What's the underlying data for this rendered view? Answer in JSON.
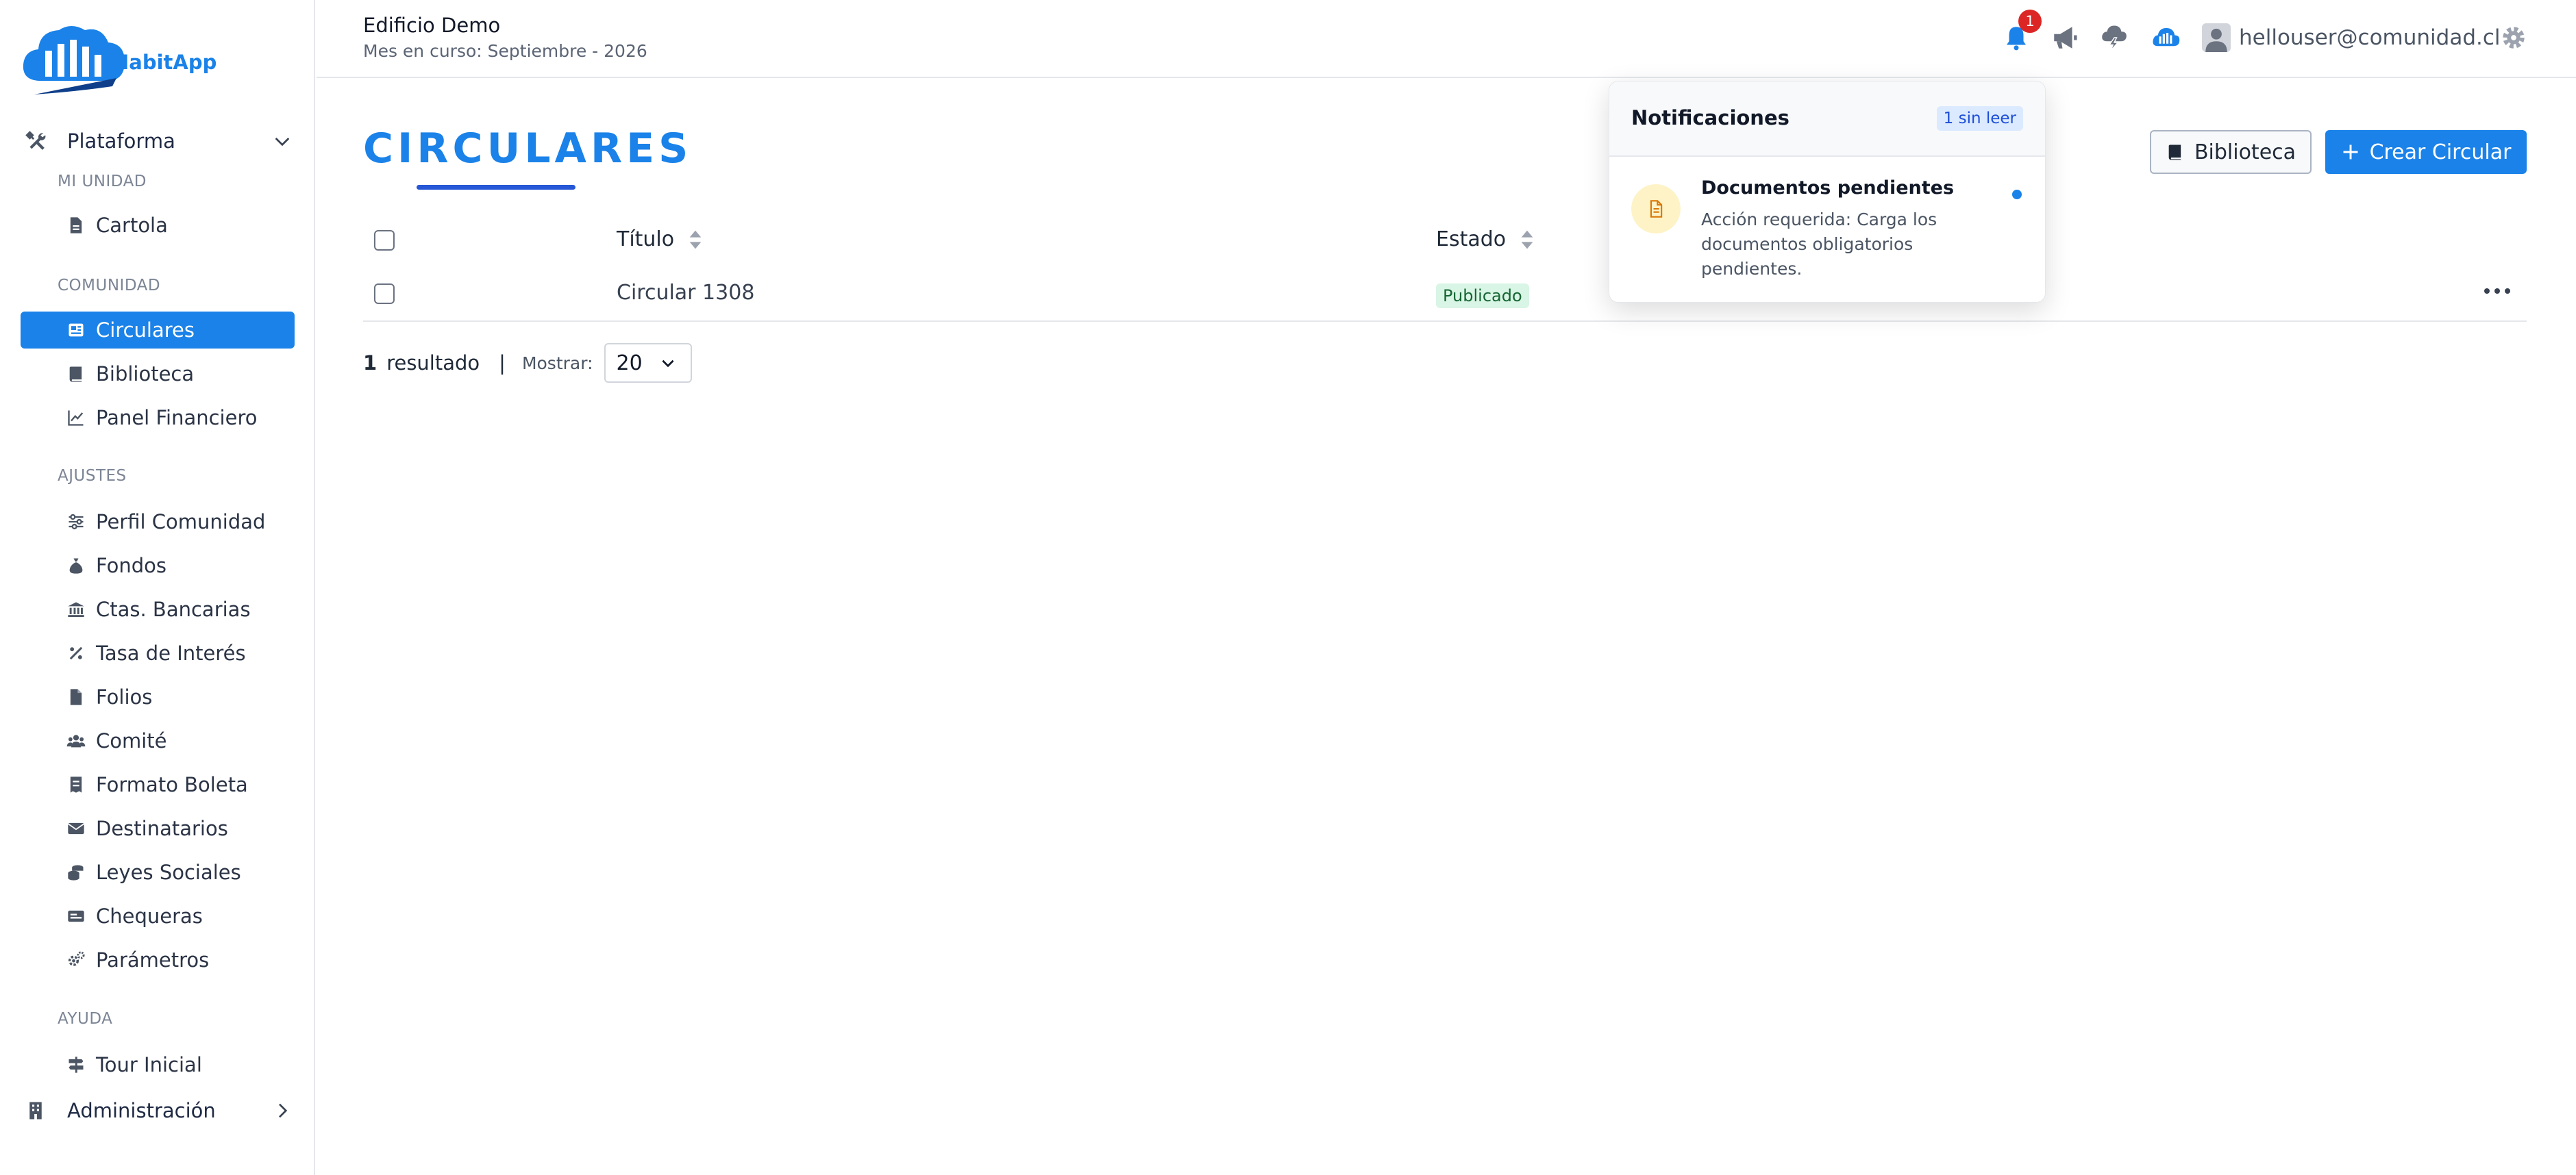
{
  "app": {
    "logo_text": "HabitApp"
  },
  "header": {
    "building": "Edificio Demo",
    "month": "Mes en curso: Septiembre - 2026",
    "notification_count": "1",
    "user_email": "hellouser@comunidad.cl",
    "icons": [
      "bell-icon",
      "megaphone-icon",
      "cloud-bolt-icon",
      "habitapp-cloud-icon",
      "user-avatar-icon",
      "gear-icon"
    ]
  },
  "sidebar": {
    "plataforma": "Plataforma",
    "administracion": "Administración",
    "sections": {
      "mi_unidad": "MI UNIDAD",
      "comunidad": "COMUNIDAD",
      "ajustes": "AJUSTES",
      "ayuda": "AYUDA"
    },
    "items": {
      "cartola": "Cartola",
      "circulares": "Circulares",
      "biblioteca": "Biblioteca",
      "panel_financiero": "Panel Financiero",
      "perfil_comunidad": "Perfil Comunidad",
      "fondos": "Fondos",
      "ctas_bancarias": "Ctas. Bancarias",
      "tasa_interes": "Tasa de Interés",
      "folios": "Folios",
      "comite": "Comité",
      "formato_boleta": "Formato Boleta",
      "destinatarios": "Destinatarios",
      "leyes_sociales": "Leyes Sociales",
      "chequeras": "Chequeras",
      "parametros": "Parámetros",
      "tour_inicial": "Tour Inicial"
    },
    "active_item": "Circulares"
  },
  "main": {
    "title": "CIRCULARES",
    "btn_biblioteca": "Biblioteca",
    "btn_crear": "Crear Circular",
    "table": {
      "columns": {
        "titulo": "Título",
        "estado": "Estado"
      },
      "rows": [
        {
          "titulo": "Circular 1308",
          "estado": "Publicado"
        }
      ]
    },
    "results_count": "1",
    "results_label": "resultado",
    "separator": "|",
    "show_label": "Mostrar:",
    "page_size": "20"
  },
  "notifications": {
    "title": "Notificaciones",
    "unread": "1 sin leer",
    "items": [
      {
        "title": "Documentos pendientes",
        "text": "Acción requerida: Carga los documentos obligatorios pendientes."
      }
    ]
  },
  "colors": {
    "accent": "#1a82e8",
    "accent_dark": "#2557d6",
    "badge": "#dc2626",
    "status_green_bg": "#d9f5e5"
  }
}
